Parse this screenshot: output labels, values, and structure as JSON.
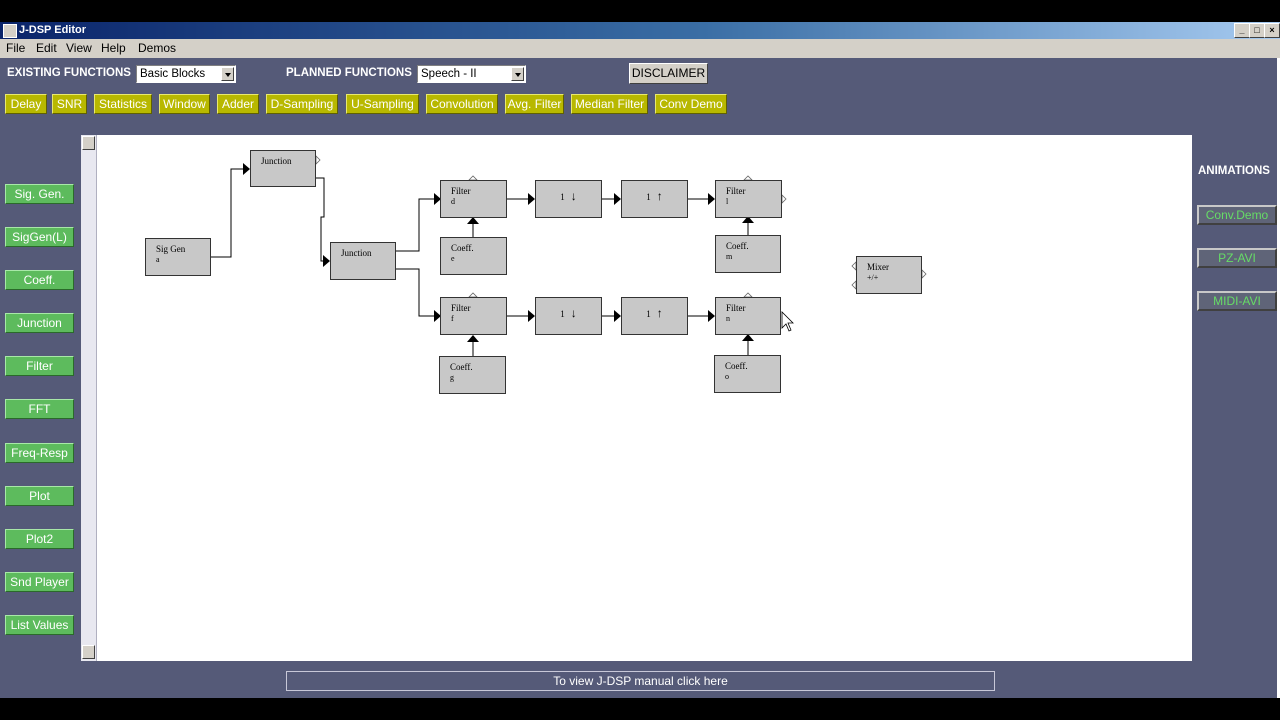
{
  "window": {
    "title": "J-DSP Editor",
    "controls": [
      "_",
      "□",
      "×"
    ]
  },
  "menu": [
    "File",
    "Edit",
    "View",
    "Help",
    "Demos"
  ],
  "toolbar": {
    "existing_label": "EXISTING FUNCTIONS",
    "existing_value": "Basic Blocks",
    "planned_label": "PLANNED FUNCTIONS",
    "planned_value": "Speech - II",
    "disclaimer": "DISCLAIMER"
  },
  "function_buttons": [
    "Delay",
    "SNR",
    "Statistics",
    "Window",
    "Adder",
    "D-Sampling",
    "U-Sampling",
    "Convolution",
    "Avg. Filter",
    "Median Filter",
    "Conv Demo"
  ],
  "palette": [
    "Sig. Gen.",
    "SigGen(L)",
    "Coeff.",
    "Junction",
    "Filter",
    "FFT",
    "Freq-Resp",
    "Plot",
    "Plot2",
    "Snd Player",
    "List Values"
  ],
  "animations": {
    "title": "ANIMATIONS",
    "items": [
      "Conv.Demo",
      "PZ-AVI",
      "MIDI-AVI"
    ]
  },
  "blocks": {
    "siggen": {
      "name": "Sig Gen",
      "id": "a"
    },
    "junction1": {
      "name": "Junction"
    },
    "junction2": {
      "name": "Junction"
    },
    "filter_d": {
      "name": "Filter",
      "id": "d"
    },
    "coeff_e": {
      "name": "Coeff.",
      "id": "e"
    },
    "filter_f": {
      "name": "Filter",
      "id": "f"
    },
    "coeff_g": {
      "name": "Coeff.",
      "id": "g"
    },
    "down1": {
      "num": "1",
      "arrow": "↓"
    },
    "up1": {
      "num": "1",
      "arrow": "↑"
    },
    "down2": {
      "num": "1",
      "arrow": "↓"
    },
    "up2": {
      "num": "1",
      "arrow": "↑"
    },
    "filter_l": {
      "name": "Filter",
      "id": "l"
    },
    "coeff_m": {
      "name": "Coeff.",
      "id": "m"
    },
    "filter_n": {
      "name": "Filter",
      "id": "n"
    },
    "coeff_o": {
      "name": "Coeff.",
      "id": "o"
    },
    "mixer": {
      "name": "Mixer",
      "id": "+/+"
    }
  },
  "manual_link": "To view J-DSP manual click here"
}
